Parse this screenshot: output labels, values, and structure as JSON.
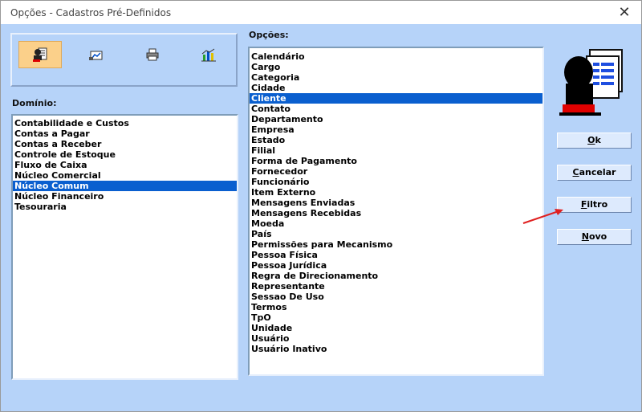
{
  "window": {
    "title": "Opções - Cadastros Pré-Definidos",
    "close_label": "✕"
  },
  "toolbar": {
    "buttons": [
      {
        "name": "contact-icon",
        "active": true
      },
      {
        "name": "chart-icon",
        "active": false
      },
      {
        "name": "printer-icon",
        "active": false
      },
      {
        "name": "bar-chart-icon",
        "active": false
      }
    ]
  },
  "dominio": {
    "label": "Domínio:",
    "items": [
      "Contabilidade e Custos",
      "Contas a Pagar",
      "Contas a Receber",
      "Controle de Estoque",
      "Fluxo de Caixa",
      "Núcleo Comercial",
      "Núcleo Comum",
      "Núcleo Financeiro",
      "Tesouraria"
    ],
    "selected": "Núcleo Comum"
  },
  "opcoes": {
    "label": "Opções:",
    "items": [
      "Calendário",
      "Cargo",
      "Categoria",
      "Cidade",
      "Cliente",
      "Contato",
      "Departamento",
      "Empresa",
      "Estado",
      "Filial",
      "Forma de Pagamento",
      "Fornecedor",
      "Funcionário",
      "Item Externo",
      "Mensagens Enviadas",
      "Mensagens Recebidas",
      "Moeda",
      "País",
      "Permissões para Mecanismo",
      "Pessoa Física",
      "Pessoa Jurídica",
      "Regra de Direcionamento",
      "Representante",
      "Sessao De Uso",
      "Termos",
      "TpO",
      "Unidade",
      "Usuário",
      "Usuário Inativo"
    ],
    "selected": "Cliente"
  },
  "buttons": {
    "ok": {
      "mnemonic": "O",
      "rest": "k"
    },
    "cancelar": {
      "mnemonic": "C",
      "rest": "ancelar"
    },
    "filtro": {
      "mnemonic": "F",
      "rest": "iltro"
    },
    "novo": {
      "mnemonic": "N",
      "rest": "ovo"
    }
  },
  "annotation": {
    "color": "#e02020"
  }
}
